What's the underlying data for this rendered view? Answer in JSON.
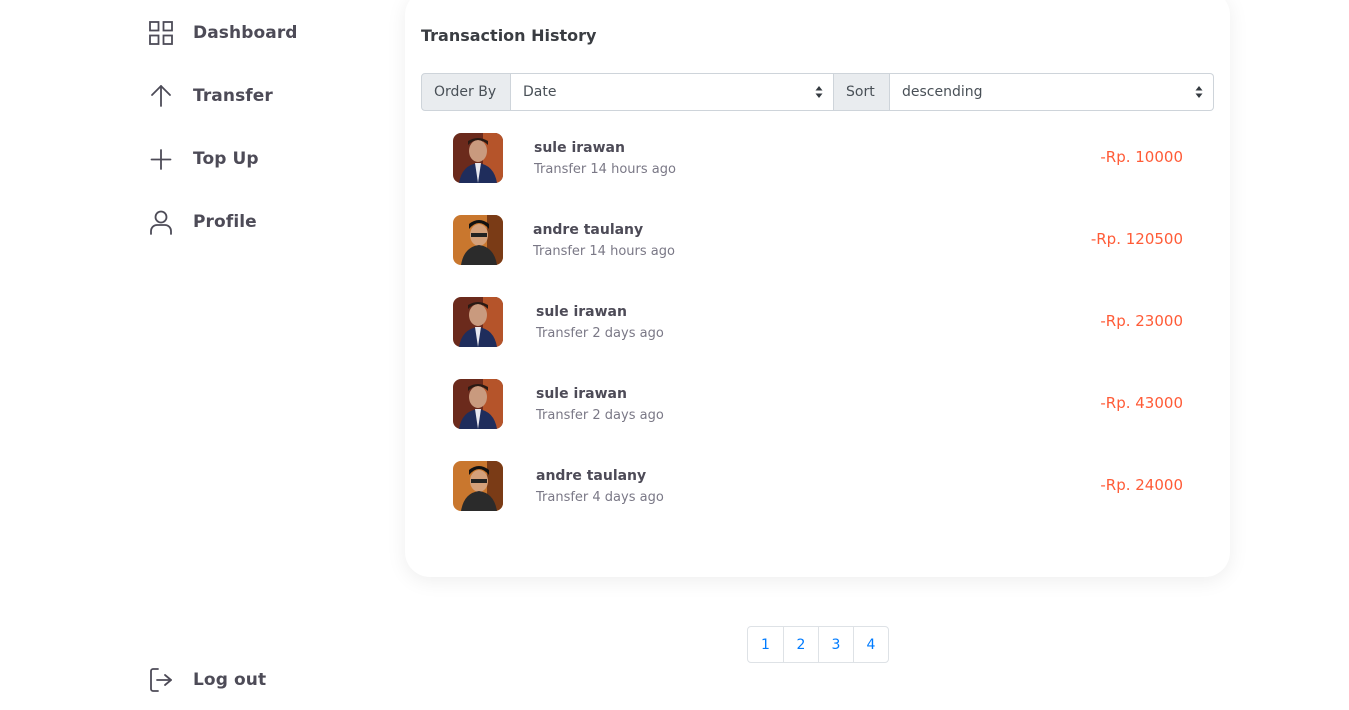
{
  "sidebar": {
    "items": [
      {
        "label": "Dashboard",
        "icon": "grid-icon"
      },
      {
        "label": "Transfer",
        "icon": "arrow-up-icon"
      },
      {
        "label": "Top Up",
        "icon": "plus-icon"
      },
      {
        "label": "Profile",
        "icon": "user-icon"
      }
    ],
    "logout": {
      "label": "Log out",
      "icon": "logout-icon"
    }
  },
  "history": {
    "title": "Transaction History",
    "order_by_label": "Order By",
    "order_by_value": "Date",
    "sort_label": "Sort",
    "sort_value": "descending",
    "transactions": [
      {
        "name": "sule irawan",
        "detail": "Transfer 14 hours ago",
        "amount": "-Rp. 10000"
      },
      {
        "name": "andre taulany",
        "detail": "Transfer 14 hours ago",
        "amount": "-Rp. 120500"
      },
      {
        "name": "sule irawan",
        "detail": "Transfer 2 days ago",
        "amount": "-Rp. 23000"
      },
      {
        "name": "sule irawan",
        "detail": "Transfer 2 days ago",
        "amount": "-Rp. 43000"
      },
      {
        "name": "andre taulany",
        "detail": "Transfer 4 days ago",
        "amount": "-Rp. 24000"
      }
    ]
  },
  "pagination": {
    "pages": [
      "1",
      "2",
      "3",
      "4"
    ]
  },
  "colors": {
    "accent": "#007bff",
    "debit": "#ff5b37",
    "text": "#4d4b57",
    "muted": "#7a7886"
  }
}
